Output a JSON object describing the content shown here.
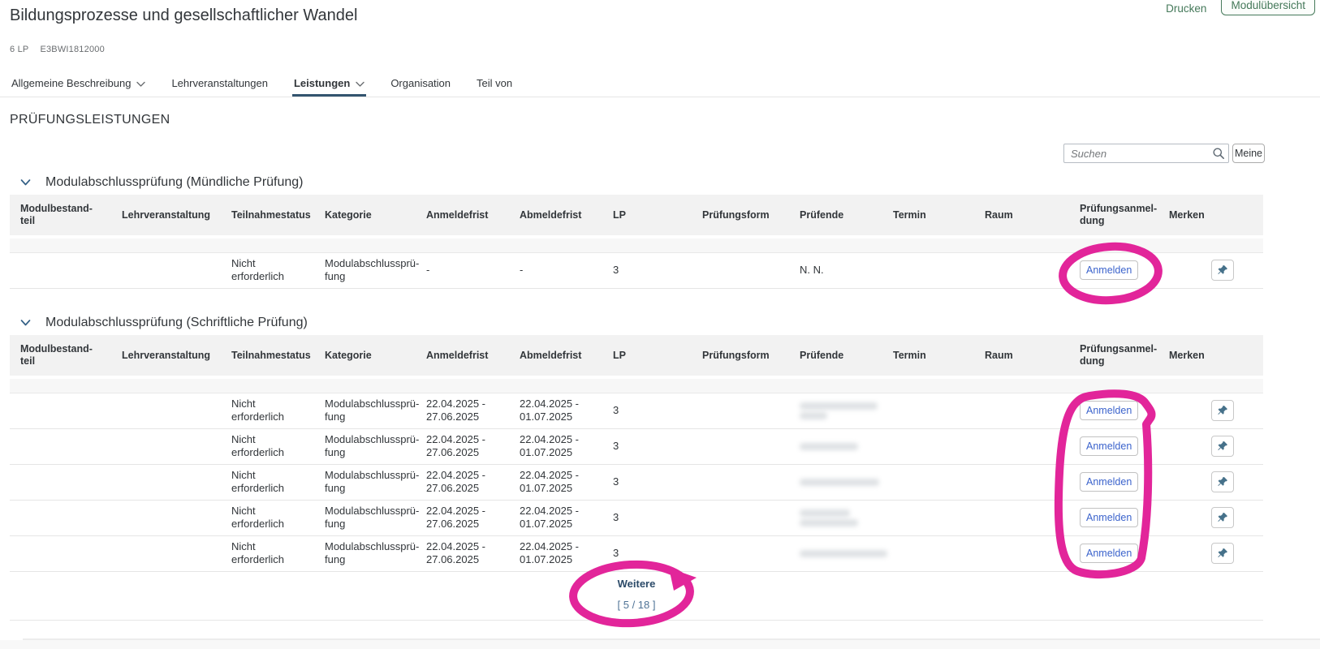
{
  "colors": {
    "annotation_pink": "#e2259a",
    "action_green": "#45795a",
    "link_blue": "#3b63cc",
    "active_tab_navy": "#33546f",
    "pin_teal": "#46718a",
    "more_link_navy": "#2b4a68",
    "counter_blue": "#4f7396"
  },
  "window_actions": {
    "print_label": "Drucken",
    "overview_button_label": "Modulübersicht"
  },
  "header": {
    "title": "Bildungsprozesse und gesellschaftlicher Wandel",
    "credits": "6 LP",
    "module_code": "E3BWI1812000"
  },
  "tabs": [
    {
      "label": "Allgemeine Beschreibung",
      "has_dropdown": true,
      "active": false
    },
    {
      "label": "Lehrveranstaltungen",
      "has_dropdown": false,
      "active": false
    },
    {
      "label": "Leistungen",
      "has_dropdown": true,
      "active": true
    },
    {
      "label": "Organisation",
      "has_dropdown": false,
      "active": false
    },
    {
      "label": "Teil von",
      "has_dropdown": false,
      "active": false
    }
  ],
  "page_title": "PRÜFUNGSLEISTUNGEN",
  "search": {
    "placeholder": "Suchen",
    "icon": "search-icon",
    "mine_button_label": "Meine"
  },
  "table_columns": [
    "Modulbestand-\nteil",
    "Lehrveranstaltung",
    "Teilnahmestatus",
    "Kategorie",
    "Anmeldefrist",
    "Abmeldefrist",
    "LP",
    "Prüfungsform",
    "Prüfende",
    "Termin",
    "Raum",
    "Prüfungsanmel-\ndung",
    "Merken"
  ],
  "sections": [
    {
      "title": "Modulabschlussprüfung (Mündliche Prüfung)",
      "rows": [
        {
          "modulbestandteil": "",
          "lehrveranstaltung": "",
          "teilnahmestatus": "Nicht erforderlich",
          "kategorie": "Modulabschlussprü-\nfung",
          "anmeldefrist": "-",
          "abmeldefrist": "-",
          "lp": "3",
          "pruefungsform": "",
          "pruefende": "N. N.",
          "termin": "",
          "raum": "",
          "anmeldung_button": "Anmelden",
          "merken_icon": "pin-icon"
        }
      ]
    },
    {
      "title": "Modulabschlussprüfung (Schriftliche Prüfung)",
      "rows": [
        {
          "modulbestandteil": "",
          "lehrveranstaltung": "",
          "teilnahmestatus": "Nicht erforderlich",
          "kategorie": "Modulabschlussprü-\nfung",
          "anmeldefrist": "22.04.2025 -\n27.06.2025",
          "abmeldefrist": "22.04.2025 -\n01.07.2025",
          "lp": "3",
          "pruefungsform": "",
          "pruefende": "",
          "pruefende_redacted": [
            96,
            34
          ],
          "termin": "",
          "raum": "",
          "anmeldung_button": "Anmelden",
          "merken_icon": "pin-icon"
        },
        {
          "modulbestandteil": "",
          "lehrveranstaltung": "",
          "teilnahmestatus": "Nicht erforderlich",
          "kategorie": "Modulabschlussprü-\nfung",
          "anmeldefrist": "22.04.2025 -\n27.06.2025",
          "abmeldefrist": "22.04.2025 -\n01.07.2025",
          "lp": "3",
          "pruefungsform": "",
          "pruefende": "",
          "pruefende_redacted": [
            72
          ],
          "termin": "",
          "raum": "",
          "anmeldung_button": "Anmelden",
          "merken_icon": "pin-icon"
        },
        {
          "modulbestandteil": "",
          "lehrveranstaltung": "",
          "teilnahmestatus": "Nicht erforderlich",
          "kategorie": "Modulabschlussprü-\nfung",
          "anmeldefrist": "22.04.2025 -\n27.06.2025",
          "abmeldefrist": "22.04.2025 -\n01.07.2025",
          "lp": "3",
          "pruefungsform": "",
          "pruefende": "",
          "pruefende_redacted": [
            98
          ],
          "termin": "",
          "raum": "",
          "anmeldung_button": "Anmelden",
          "merken_icon": "pin-icon"
        },
        {
          "modulbestandteil": "",
          "lehrveranstaltung": "",
          "teilnahmestatus": "Nicht erforderlich",
          "kategorie": "Modulabschlussprü-\nfung",
          "anmeldefrist": "22.04.2025 -\n27.06.2025",
          "abmeldefrist": "22.04.2025 -\n01.07.2025",
          "lp": "3",
          "pruefungsform": "",
          "pruefende": "",
          "pruefende_redacted": [
            62,
            72
          ],
          "termin": "",
          "raum": "",
          "anmeldung_button": "Anmelden",
          "merken_icon": "pin-icon"
        },
        {
          "modulbestandteil": "",
          "lehrveranstaltung": "",
          "teilnahmestatus": "Nicht erforderlich",
          "kategorie": "Modulabschlussprü-\nfung",
          "anmeldefrist": "22.04.2025 -\n27.06.2025",
          "abmeldefrist": "22.04.2025 -\n01.07.2025",
          "lp": "3",
          "pruefungsform": "",
          "pruefende": "",
          "pruefende_redacted": [
            108
          ],
          "termin": "",
          "raum": "",
          "anmeldung_button": "Anmelden",
          "merken_icon": "pin-icon"
        }
      ],
      "pagination": {
        "more_label": "Weitere",
        "counter": "[ 5 / 18 ]"
      }
    }
  ]
}
